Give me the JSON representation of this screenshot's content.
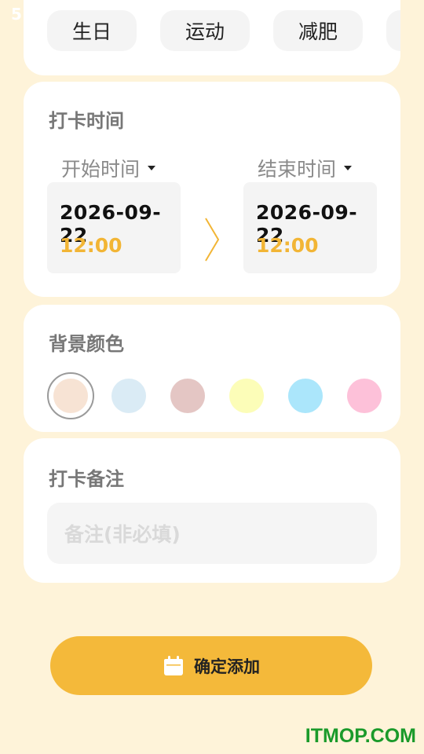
{
  "status_bar": {
    "time_fragment": "5"
  },
  "tags": {
    "items": [
      "生日",
      "运动",
      "减肥"
    ]
  },
  "checkin_time": {
    "title": "打卡时间",
    "start_label": "开始时间",
    "end_label": "结束时间",
    "start_date": "2026-09-22",
    "start_time": "12:00",
    "end_date": "2026-09-22",
    "end_time": "12:00"
  },
  "background_color": {
    "title": "背景颜色",
    "swatches": [
      "#F7E3D4",
      "#DAEBF5",
      "#E4C6C4",
      "#FCFDB8",
      "#ABE6FB",
      "#FDC1D9"
    ],
    "selected_index": 0
  },
  "checkin_note": {
    "title": "打卡备注",
    "placeholder": "备注(非必填)"
  },
  "submit": {
    "label": "确定添加"
  },
  "watermark": "ITMOP.COM",
  "colors": {
    "page_bg": "#FEF3D9",
    "accent": "#F4B93A",
    "time_accent": "#F2B535"
  }
}
